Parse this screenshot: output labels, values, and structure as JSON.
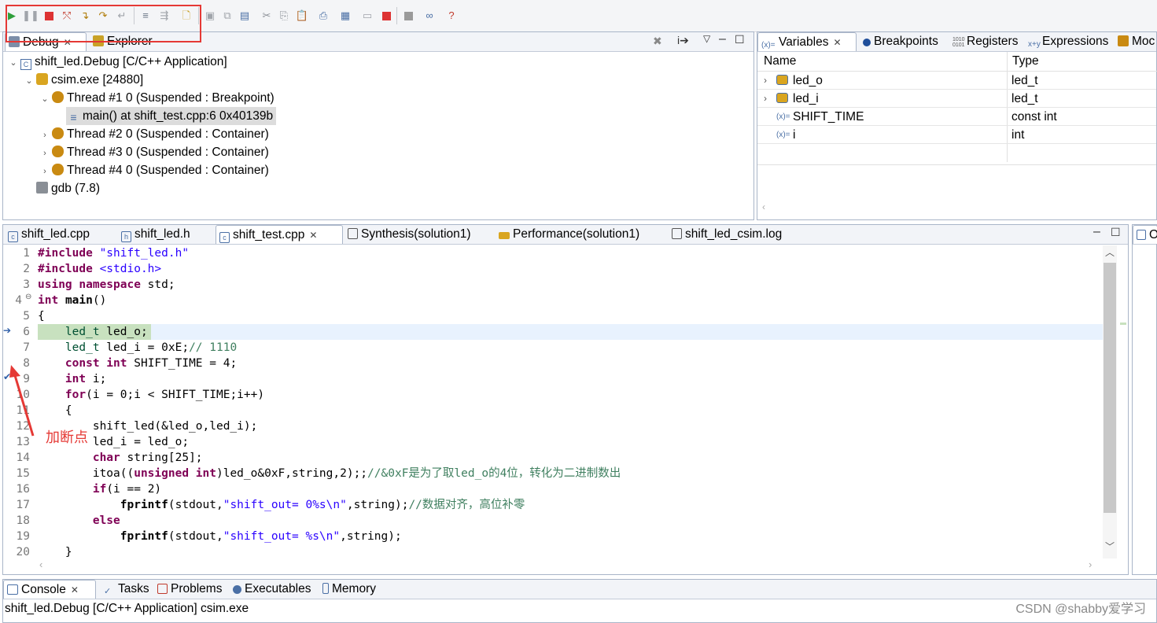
{
  "toolbar": {
    "icons": [
      "resume-icon",
      "suspend-icon",
      "terminate-icon",
      "disconnect-icon",
      "step-into-icon",
      "step-over-icon",
      "step-return-icon",
      "drop-to-frame-icon",
      "use-step-filters-icon",
      "new-file-icon",
      "save-icon",
      "save-all-icon",
      "cut-icon",
      "copy-icon",
      "paste-icon",
      "print-icon",
      "synthesis-icon",
      "cosim-icon",
      "stop-icon",
      "run-icon",
      "link-icon",
      "help-icon"
    ],
    "highlight_color": "#e53935"
  },
  "debug_view": {
    "tabs": [
      {
        "label": "Debug",
        "active": true
      },
      {
        "label": "Explorer",
        "active": false
      }
    ],
    "tree": [
      {
        "label": "shift_led.Debug [C/C++ Application]"
      },
      {
        "label": "csim.exe [24880]"
      },
      {
        "label": "Thread #1 0 (Suspended : Breakpoint)"
      },
      {
        "label": "main() at shift_test.cpp:6 0x40139b"
      },
      {
        "label": "Thread #2 0 (Suspended : Container)"
      },
      {
        "label": "Thread #3 0 (Suspended : Container)"
      },
      {
        "label": "Thread #4 0 (Suspended : Container)"
      },
      {
        "label": "gdb (7.8)"
      }
    ]
  },
  "variables_view": {
    "tabs": [
      "Variables",
      "Breakpoints",
      "Registers",
      "Expressions",
      "Moc"
    ],
    "columns": [
      "Name",
      "Type"
    ],
    "rows": [
      {
        "name": "led_o",
        "type": "led_t"
      },
      {
        "name": "led_i",
        "type": "led_t"
      },
      {
        "name": "SHIFT_TIME",
        "type": "const int"
      },
      {
        "name": "i",
        "type": "int"
      }
    ]
  },
  "editor": {
    "tabs": [
      {
        "label": "shift_led.cpp",
        "active": false
      },
      {
        "label": "shift_led.h",
        "active": false
      },
      {
        "label": "shift_test.cpp",
        "active": true
      },
      {
        "label": "Synthesis(solution1)",
        "active": false
      },
      {
        "label": "Performance(solution1)",
        "active": false
      },
      {
        "label": "shift_led_csim.log",
        "active": false
      }
    ],
    "line_numbers": [
      "1",
      "2",
      "3",
      "4",
      "5",
      "6",
      "7",
      "8",
      "9",
      "10",
      "11",
      "12",
      "13",
      "14",
      "15",
      "16",
      "17",
      "18",
      "19",
      "20"
    ],
    "current_line": "6",
    "annotation": "加断点",
    "annotation_color": "#e53935",
    "highlight_color": "#c8e1bf"
  },
  "console_view": {
    "tabs": [
      "Console",
      "Tasks",
      "Problems",
      "Executables",
      "Memory"
    ],
    "status": "shift_led.Debug [C/C++ Application] csim.exe"
  },
  "outline_tab": "O",
  "watermark": "CSDN @shabby爱学习"
}
